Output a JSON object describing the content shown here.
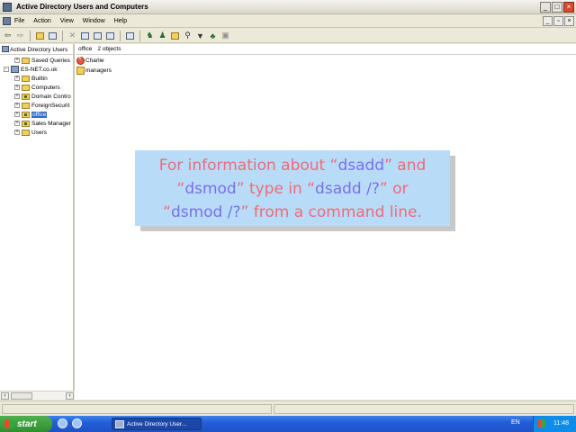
{
  "window": {
    "title": "Active Directory Users and Computers"
  },
  "menu": {
    "items": [
      "File",
      "Action",
      "View",
      "Window",
      "Help"
    ]
  },
  "toolbar": {
    "buttons": [
      "back-arrow-icon",
      "forward-arrow-icon",
      "up-folder-icon",
      "console-tree-icon",
      "delete-icon",
      "properties-icon",
      "refresh-icon",
      "export-icon",
      "help-icon",
      "new-user-icon",
      "new-group-icon",
      "new-ou-icon",
      "find-icon",
      "filter-icon",
      "add-to-group-icon",
      "delegate-icon"
    ]
  },
  "tree": {
    "header": "Active Directory Users",
    "items": [
      {
        "label": "Saved Queries",
        "depth": 1,
        "expander": "+",
        "icon": "folder"
      },
      {
        "label": "ES-NET.co.uk",
        "depth": 0,
        "expander": "-",
        "icon": "domain"
      },
      {
        "label": "Builtin",
        "depth": 1,
        "expander": "+",
        "icon": "folder"
      },
      {
        "label": "Computers",
        "depth": 1,
        "expander": "+",
        "icon": "folder"
      },
      {
        "label": "Domain Contro",
        "depth": 1,
        "expander": "+",
        "icon": "ou"
      },
      {
        "label": "ForeignSecurit",
        "depth": 1,
        "expander": "+",
        "icon": "folder"
      },
      {
        "label": "office",
        "depth": 1,
        "expander": "+",
        "icon": "ou",
        "selected": true
      },
      {
        "label": "Sales Manager",
        "depth": 1,
        "expander": "+",
        "icon": "ou"
      },
      {
        "label": "Users",
        "depth": 1,
        "expander": "+",
        "icon": "folder"
      }
    ]
  },
  "list": {
    "header_name": "office",
    "header_count": "2 objects",
    "items": [
      {
        "label": "Charlie",
        "icon": "disabled-user"
      },
      {
        "label": "managers",
        "icon": "group"
      }
    ]
  },
  "callout": {
    "line1_a": "For information about “",
    "line1_b": "dsadd",
    "line1_c": "” and",
    "line2_a": "“",
    "line2_b": "dsmod",
    "line2_c": "” type in “",
    "line2_d": "dsadd /?",
    "line2_e": "” or",
    "line3_a": "“",
    "line3_b": "dsmod /?",
    "line3_c": "” from a command line."
  },
  "taskbar": {
    "start_label": "start",
    "task_label": "Active Directory User...",
    "language": "EN",
    "clock": "11:48"
  }
}
